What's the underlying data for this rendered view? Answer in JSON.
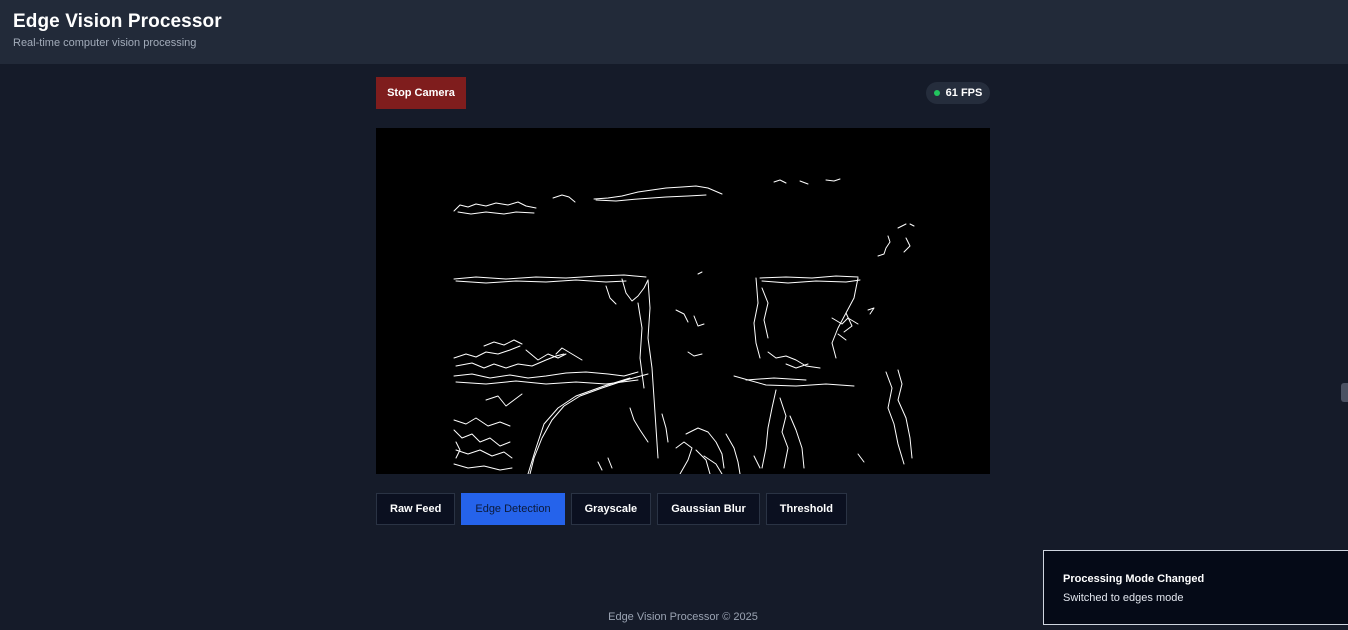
{
  "app": {
    "title": "Edge Vision Processor",
    "subtitle": "Real-time computer vision processing"
  },
  "controls": {
    "stop_label": "Stop Camera",
    "fps_text": "61 FPS",
    "fps_status_color": "#22c55e"
  },
  "modes": [
    {
      "label": "Raw Feed",
      "active": false
    },
    {
      "label": "Edge Detection",
      "active": true
    },
    {
      "label": "Grayscale",
      "active": false
    },
    {
      "label": "Gaussian Blur",
      "active": false
    },
    {
      "label": "Threshold",
      "active": false
    }
  ],
  "footer": {
    "text": "Edge Vision Processor © 2025"
  },
  "toast": {
    "title": "Processing Mode Changed",
    "message": "Switched to edges mode"
  },
  "colors": {
    "accent": "#2563eb",
    "danger": "#7f1d1d",
    "header_bg": "#222a39",
    "page_bg": "#151b29"
  }
}
